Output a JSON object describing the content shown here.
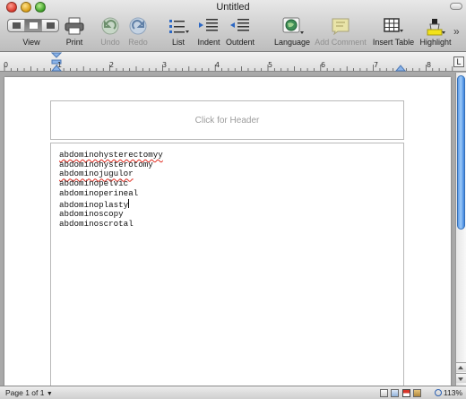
{
  "window": {
    "title": "Untitled"
  },
  "toolbar": {
    "view_label": "View",
    "print_label": "Print",
    "undo_label": "Undo",
    "redo_label": "Redo",
    "list_label": "List",
    "indent_label": "Indent",
    "outdent_label": "Outdent",
    "language_label": "Language",
    "add_comment_label": "Add Comment",
    "insert_table_label": "Insert Table",
    "highlight_label": "Highlight",
    "overflow_glyph": "»"
  },
  "ruler": {
    "numbers": [
      "0",
      "1",
      "2",
      "3",
      "4",
      "5",
      "6",
      "7",
      "8"
    ],
    "tab_stop_button": "L"
  },
  "document": {
    "header_placeholder": "Click for Header",
    "lines": [
      {
        "text": "abdominohysterectomyy",
        "misspelled": true
      },
      {
        "text": "abdominohysterotomy",
        "misspelled": false
      },
      {
        "text": "abdominojugulor",
        "misspelled": true
      },
      {
        "text": "abdominopelvic",
        "misspelled": false
      },
      {
        "text": "abdominoperineal",
        "misspelled": false
      },
      {
        "text": "abdominoplasty",
        "misspelled": false,
        "caret": true
      },
      {
        "text": "abdominoscopy",
        "misspelled": false
      },
      {
        "text": "abdominoscrotal",
        "misspelled": false
      }
    ]
  },
  "status": {
    "page_text": "Page 1 of 1",
    "page_menu_glyph": "▼",
    "zoom": "113%"
  },
  "colors": {
    "spelling_underline": "#e0291d",
    "scroll_thumb": "#5e9ce8",
    "insert_table_accent": "#333333",
    "highlight_accent": "#f2e21a"
  }
}
